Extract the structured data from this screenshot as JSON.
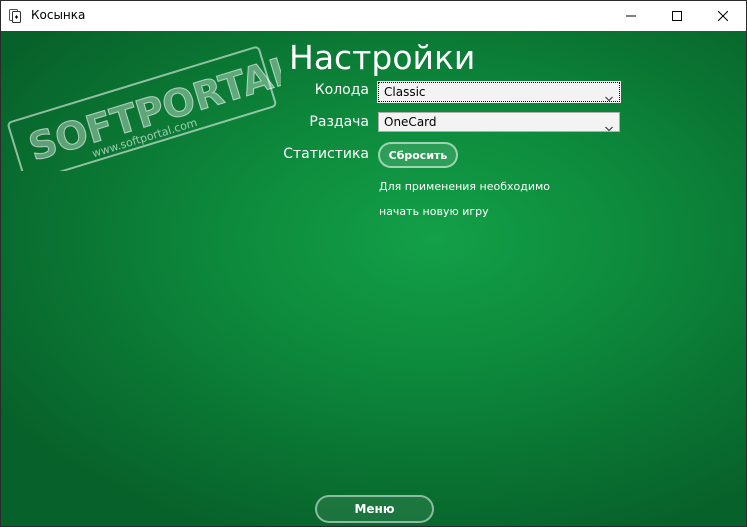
{
  "window": {
    "title": "Косынка"
  },
  "settings": {
    "title": "Настройки",
    "deck_label": "Колода",
    "deck_value": "Classic",
    "deal_label": "Раздача",
    "deal_value": "OneCard",
    "stats_label": "Статистика",
    "reset_label": "Сбросить",
    "hint_line1": "Для применения необходимо",
    "hint_line2": "начать новую игру"
  },
  "footer": {
    "menu_label": "Меню"
  },
  "watermark": {
    "brand": "SOFTPORTAL",
    "url": "www.softportal.com"
  },
  "colors": {
    "felt_center": "#13a048",
    "felt_edge": "#07612a",
    "text": "#ffffff"
  },
  "icons": {
    "app": "cards-icon",
    "minimize": "minimize-icon",
    "maximize": "maximize-icon",
    "close": "close-icon",
    "dropdown": "chevron-down-icon"
  }
}
